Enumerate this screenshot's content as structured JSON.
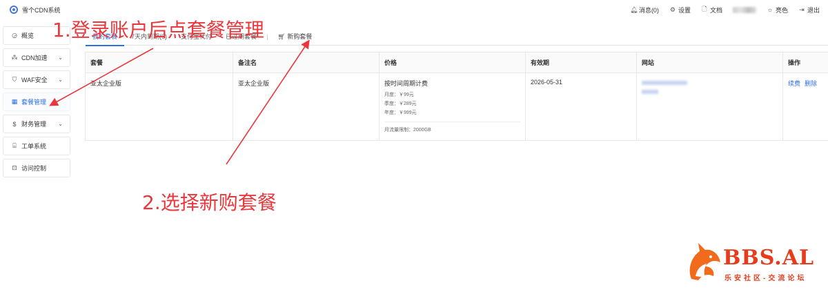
{
  "topbar": {
    "title": "雪个CDN系统",
    "items": [
      {
        "label": "消息(0)",
        "icon": "bell-icon"
      },
      {
        "label": "设置",
        "icon": "gear-icon"
      },
      {
        "label": "文档",
        "icon": "document-icon"
      },
      {
        "label": "亮色",
        "icon": "sun-icon"
      },
      {
        "label": "退出",
        "icon": "logout-icon"
      }
    ]
  },
  "sidebar": {
    "items": [
      {
        "label": "概览",
        "icon": "dashboard-icon"
      },
      {
        "label": "CDN加速",
        "icon": "network-icon"
      },
      {
        "label": "WAF安全",
        "icon": "shield-icon"
      },
      {
        "label": "套餐管理",
        "icon": "grid-icon"
      },
      {
        "label": "财务管理",
        "icon": "dollar-icon"
      },
      {
        "label": "工单系统",
        "icon": "ticket-icon"
      },
      {
        "label": "访问控制",
        "icon": "access-icon"
      }
    ]
  },
  "tabs": {
    "items": [
      "我的套餐",
      "7天内到期(0)",
      "支付宝代付",
      "已过期套餐"
    ],
    "new_label": "新购套餐"
  },
  "table": {
    "headers": [
      "套餐",
      "备注名",
      "价格",
      "有效期",
      "网站",
      "操作"
    ],
    "row": {
      "package": "亚太企业版",
      "note": "亚太企业版",
      "price_title": "按时间周期计费",
      "price_month": "月度：￥99元",
      "price_quarter": "季度：￥289元",
      "price_year": "年度：￥999元",
      "traffic": "月流量限制：2000GB",
      "expiry": "2026-05-31",
      "op_renew": "续费",
      "op_delete": "删除"
    }
  },
  "annotations": {
    "step1": "1.登录账户后点套餐管理",
    "step2": "2.选择新购套餐",
    "color": "#e8383d"
  },
  "watermark": {
    "brand": "BBS.AL",
    "slogan": "乐安社区-交流论坛"
  }
}
